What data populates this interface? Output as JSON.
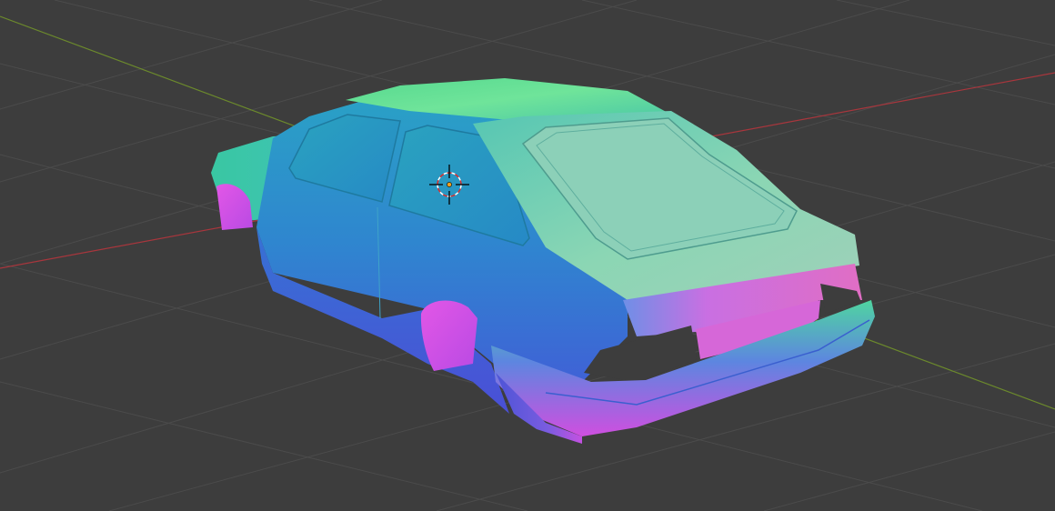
{
  "viewport": {
    "mode": "3D viewport",
    "shading": "normal",
    "background_color": "#3d3d3d",
    "grid_line_color": "#4b4b4b",
    "x_axis_color": "#a8363d",
    "y_axis_color": "#6c8a2c"
  },
  "scene": {
    "object": "car-body",
    "cursor": "3d-cursor-icon"
  }
}
